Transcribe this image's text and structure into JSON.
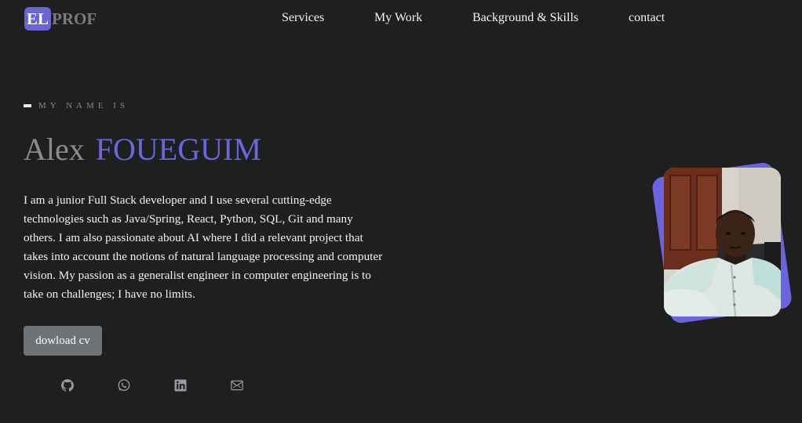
{
  "logo": {
    "badge": "EL",
    "text": "PROF"
  },
  "nav": {
    "items": [
      {
        "label": "Services"
      },
      {
        "label": "My Work"
      },
      {
        "label": "Background & Skills"
      },
      {
        "label": "contact"
      }
    ]
  },
  "hero": {
    "eyebrow": "MY NAME IS",
    "first_name": "Alex",
    "last_name": "FOUEGUIM",
    "bio": "I am a junior Full Stack developer and I use several cutting-edge technologies such as Java/Spring, React, Python, SQL, Git and many others. I am also passionate about AI where I did a relevant project that takes into account the notions of natural language processing and computer vision. My passion as a generalist engineer in computer engineering is to take on challenges; I have no limits.",
    "cv_button": "dowload cv"
  },
  "socials": [
    "github-icon",
    "whatsapp-icon",
    "linkedin-icon",
    "mail-icon"
  ],
  "colors": {
    "background": "#1f1f20",
    "accent": "#6b66e0",
    "button": "#6f7378",
    "muted": "#8c8c90"
  }
}
